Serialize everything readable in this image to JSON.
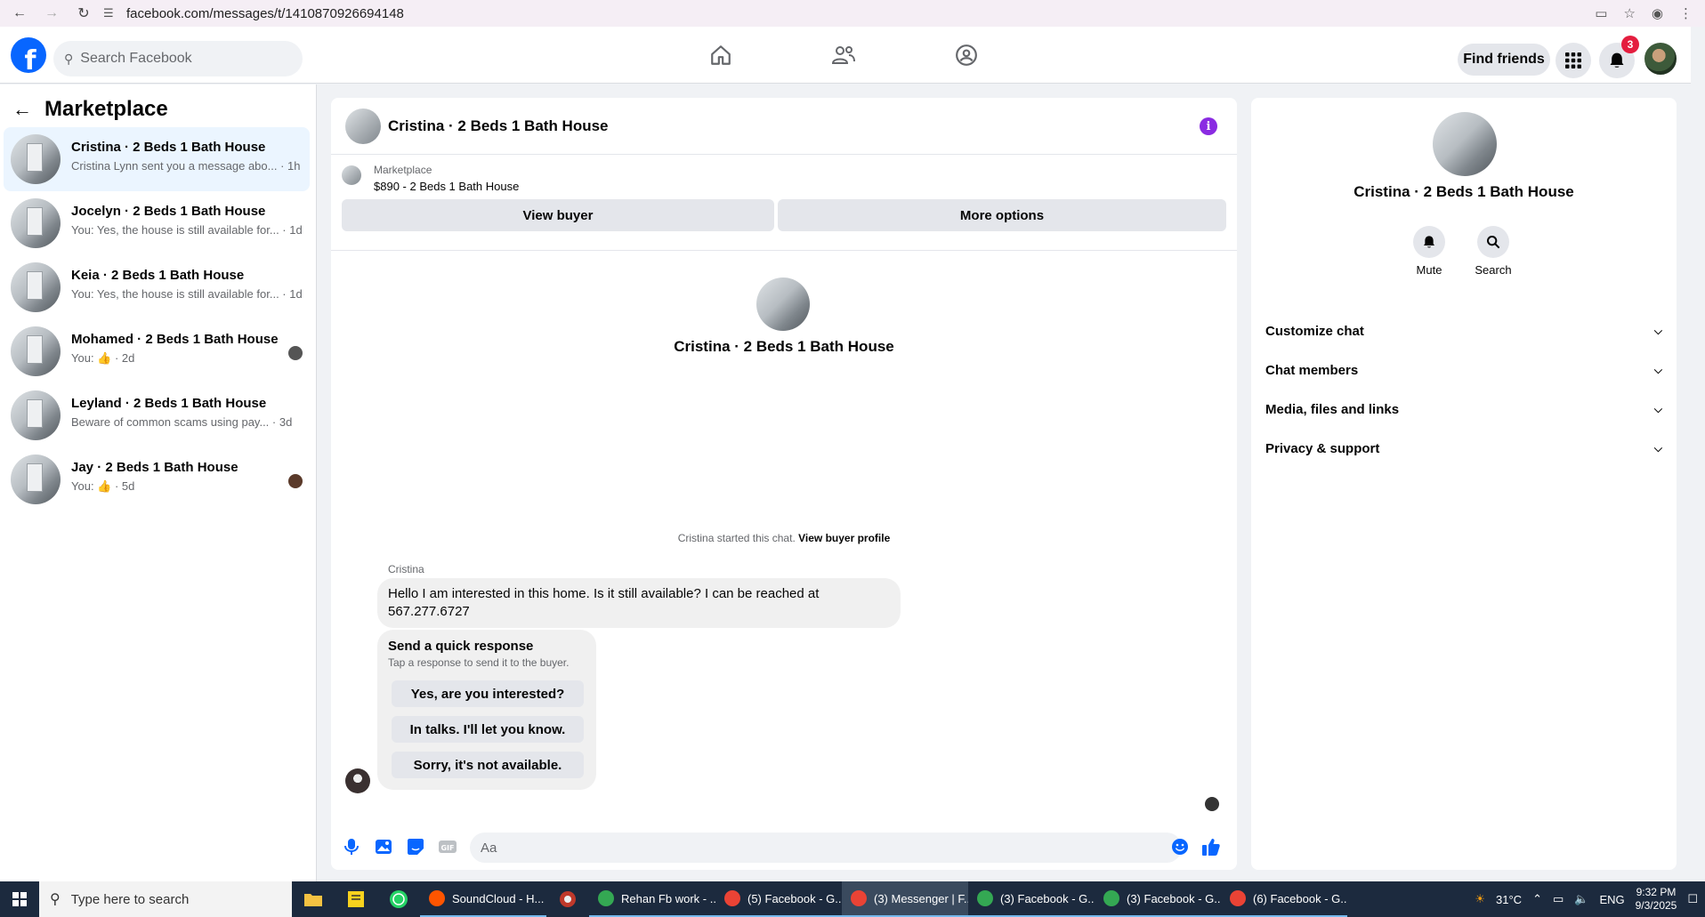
{
  "browser": {
    "url": "facebook.com/messages/t/1410870926694148"
  },
  "fb_header": {
    "search_placeholder": "Search Facebook",
    "find_friends_label": "Find friends",
    "notification_count": "3"
  },
  "sidebar": {
    "title": "Marketplace",
    "conversations": [
      {
        "name": "Cristina · 2 Beds 1 Bath House",
        "preview": "Cristina Lynn sent you a message abo... · 1h",
        "active": true
      },
      {
        "name": "Jocelyn · 2 Beds 1 Bath House",
        "preview": "You: Yes, the house is still available for... · 1d",
        "active": false
      },
      {
        "name": "Keia · 2 Beds 1 Bath House",
        "preview": "You: Yes, the house is still available for... · 1d",
        "active": false
      },
      {
        "name": "Mohamed · 2 Beds 1 Bath House",
        "preview": "You: 👍 · 2d",
        "active": false
      },
      {
        "name": "Leyland · 2 Beds 1 Bath House",
        "preview": "Beware of common scams using pay... · 3d",
        "active": false
      },
      {
        "name": "Jay · 2 Beds 1 Bath House",
        "preview": "You: 👍 · 5d",
        "active": false
      }
    ]
  },
  "chat": {
    "title": "Cristina · 2 Beds 1 Bath House",
    "listing_source": "Marketplace",
    "listing_price": "$890 - 2 Beds 1 Bath House",
    "view_buyer_label": "View buyer",
    "more_options_label": "More options",
    "intro_name": "Cristina · 2 Beds 1 Bath House",
    "started_text": "Cristina started this chat.",
    "view_buyer_profile_label": "View buyer profile",
    "sender_name": "Cristina",
    "message_text": "Hello I am interested in this home. Is it still available? I can be reached at 567.277.6727",
    "quick_title": "Send a quick response",
    "quick_subtitle": "Tap a response to send it to the buyer.",
    "quick_responses": [
      "Yes, are you interested?",
      "In talks. I'll let you know.",
      "Sorry, it's not available."
    ],
    "input_placeholder": "Aa"
  },
  "right_panel": {
    "name": "Cristina · 2 Beds 1 Bath House",
    "mute_label": "Mute",
    "search_label": "Search",
    "sections": [
      "Customize chat",
      "Chat members",
      "Media, files and links",
      "Privacy & support"
    ]
  },
  "taskbar": {
    "search_placeholder": "Type here to search",
    "tasks": [
      {
        "label": "SoundCloud - H...",
        "color": "#ff5500",
        "active": false
      },
      {
        "label": "Rehan Fb work - ...",
        "color": "#34a853",
        "active": false
      },
      {
        "label": "(5) Facebook - G...",
        "color": "#ea4335",
        "active": false
      },
      {
        "label": "(3) Messenger | F...",
        "color": "#ea4335",
        "active": true
      },
      {
        "label": "(3) Facebook - G...",
        "color": "#34a853",
        "active": false
      },
      {
        "label": "(3) Facebook - G...",
        "color": "#34a853",
        "active": false
      },
      {
        "label": "(6) Facebook - G...",
        "color": "#ea4335",
        "active": false
      }
    ],
    "weather": "31°C",
    "language": "ENG",
    "time": "9:32 PM",
    "date": "9/3/2025"
  }
}
